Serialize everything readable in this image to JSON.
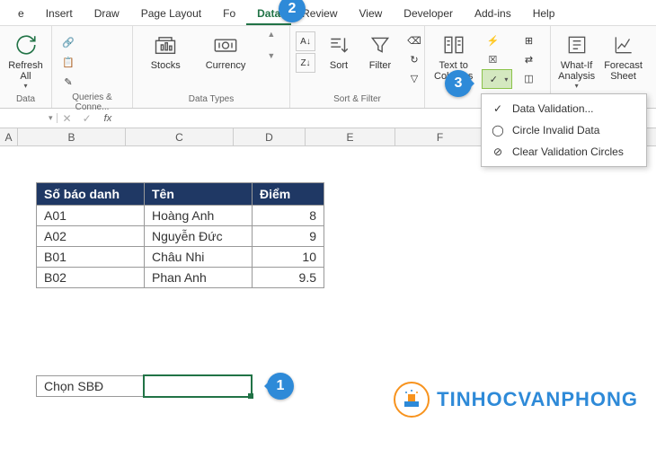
{
  "tabs": {
    "items": [
      "e",
      "Insert",
      "Draw",
      "Page Layout",
      "Fo",
      "Data",
      "Review",
      "View",
      "Developer",
      "Add-ins",
      "Help"
    ],
    "active": 5
  },
  "ribbon": {
    "group0": {
      "label": "Data",
      "btn_refresh": "Refresh\nAll"
    },
    "group1": {
      "label": "Queries & Conne..."
    },
    "group2": {
      "label": "Data Types",
      "btn_stocks": "Stocks",
      "btn_currency": "Currency"
    },
    "group3": {
      "label": "Sort & Filter",
      "btn_sort": "Sort",
      "btn_filter": "Filter"
    },
    "group5": {
      "btn_textcol": "Text to\nColumns"
    },
    "group6": {
      "btn_whatif": "What-If\nAnalysis",
      "btn_forecast": "Forecast\nSheet"
    }
  },
  "formula_bar": {
    "fx": "fx",
    "value": ""
  },
  "columns": [
    "A",
    "B",
    "C",
    "D",
    "E",
    "F"
  ],
  "table": {
    "headers": [
      "Số báo danh",
      "Tên",
      "Điểm"
    ],
    "rows": [
      [
        "A01",
        "Hoàng Anh",
        "8"
      ],
      [
        "A02",
        "Nguyễn Đức",
        "9"
      ],
      [
        "B01",
        "Châu Nhi",
        "10"
      ],
      [
        "B02",
        "Phan Anh",
        "9.5"
      ]
    ]
  },
  "lookup": {
    "label": "Chọn SBĐ",
    "value": ""
  },
  "dropdown": {
    "items": [
      "Data Validation...",
      "Circle Invalid Data",
      "Clear Validation Circles"
    ]
  },
  "callouts": {
    "c1": "1",
    "c2": "2",
    "c3": "3"
  },
  "watermark": {
    "text": "TINHOCVANPHONG"
  }
}
